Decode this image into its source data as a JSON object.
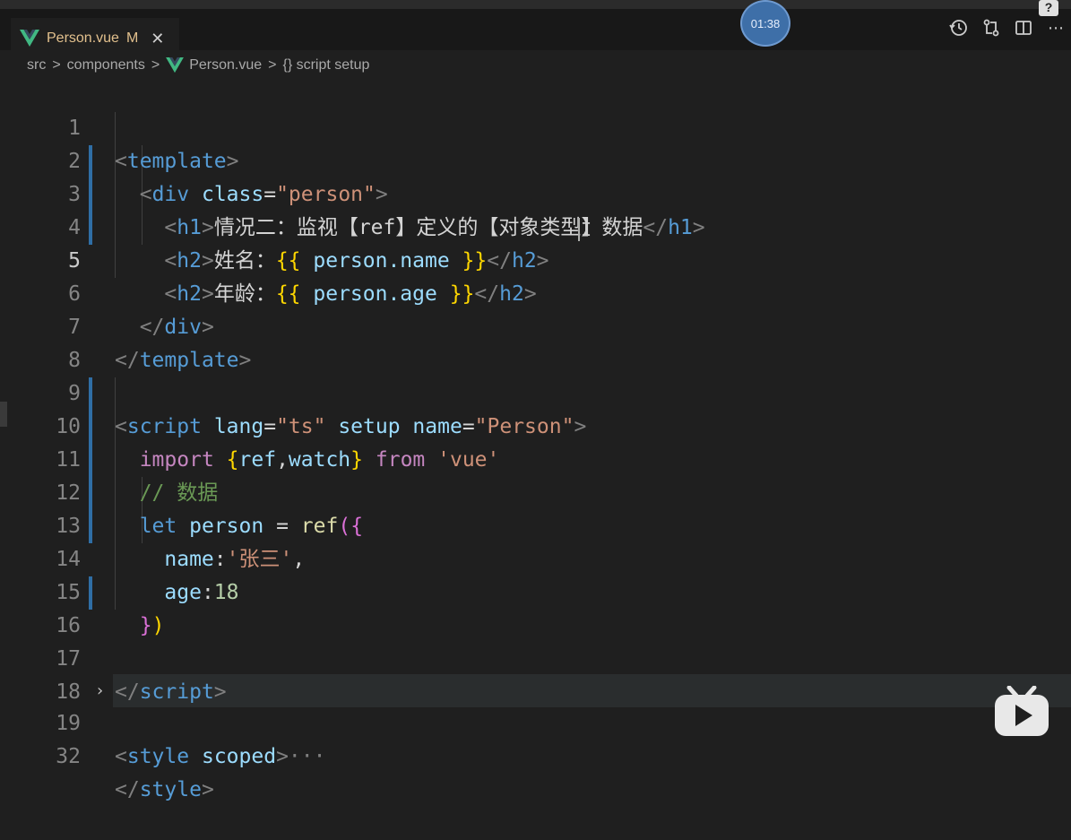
{
  "tab": {
    "file_name": "Person.vue",
    "modified_badge": "M",
    "close_glyph": "✕"
  },
  "timer": {
    "text": "01:38"
  },
  "help_badge": "?",
  "actions": {
    "history_icon": "history-icon",
    "compare_icon": "compare-changes-icon",
    "split_icon": "split-editor-icon",
    "more_icon": "more-actions-icon",
    "more_glyph": "⋯"
  },
  "breadcrumb": {
    "items": [
      "src",
      "components",
      "Person.vue",
      "{} script setup"
    ],
    "separator": ">"
  },
  "editor": {
    "line_numbers": [
      "1",
      "2",
      "3",
      "4",
      "5",
      "6",
      "7",
      "8",
      "9",
      "10",
      "11",
      "12",
      "13",
      "14",
      "15",
      "16",
      "17",
      "18",
      "19",
      "32"
    ],
    "active_line": "5",
    "lines": {
      "l1": [
        "<",
        "template",
        ">"
      ],
      "l2": [
        "<",
        "div",
        "class",
        "=",
        "\"person\"",
        ">"
      ],
      "l3": [
        "<",
        "h1",
        ">",
        "情况二：监视【ref】定义的【对象类型】数据",
        "</",
        "h1",
        ">"
      ],
      "l4": [
        "<",
        "h2",
        ">",
        "姓名：",
        "{{",
        "person.name",
        "}}",
        "</",
        "h2",
        ">"
      ],
      "l5": [
        "<",
        "h2",
        ">",
        "年龄：",
        "{{",
        "person.age",
        "}}",
        "</",
        "h2",
        ">"
      ],
      "l6": [
        "</",
        "div",
        ">"
      ],
      "l7": [
        "</",
        "template",
        ">"
      ],
      "l9": [
        "<",
        "script",
        "lang",
        "=",
        "\"ts\"",
        "setup",
        "name",
        "=",
        "\"Person\"",
        ">"
      ],
      "l10": [
        "import",
        "{",
        "ref",
        ",",
        "watch",
        "}",
        "from",
        "'vue'"
      ],
      "l11": [
        "// 数据"
      ],
      "l12": [
        "let",
        "person",
        "=",
        "ref",
        "(",
        "{"
      ],
      "l13": [
        "name",
        ":",
        "'张三'",
        ","
      ],
      "l14": [
        "age",
        ":",
        "18"
      ],
      "l15": [
        "}",
        ")"
      ],
      "l17": [
        "</",
        "script",
        ">"
      ],
      "l19": [
        "<",
        "style",
        "scoped",
        ">",
        "···"
      ],
      "l32": [
        "</",
        "style",
        ">"
      ]
    }
  },
  "overlay": {
    "play_icon": "bilibili-play-icon"
  },
  "colors": {
    "background": "#1f1f1f",
    "tag": "#808080",
    "tag_name": "#569cd6",
    "attribute": "#9cdcfe",
    "string": "#ce9178",
    "keyword": "#c586c0",
    "comment": "#6a9955",
    "number": "#b5cea8",
    "modified": "#e2c08d"
  }
}
